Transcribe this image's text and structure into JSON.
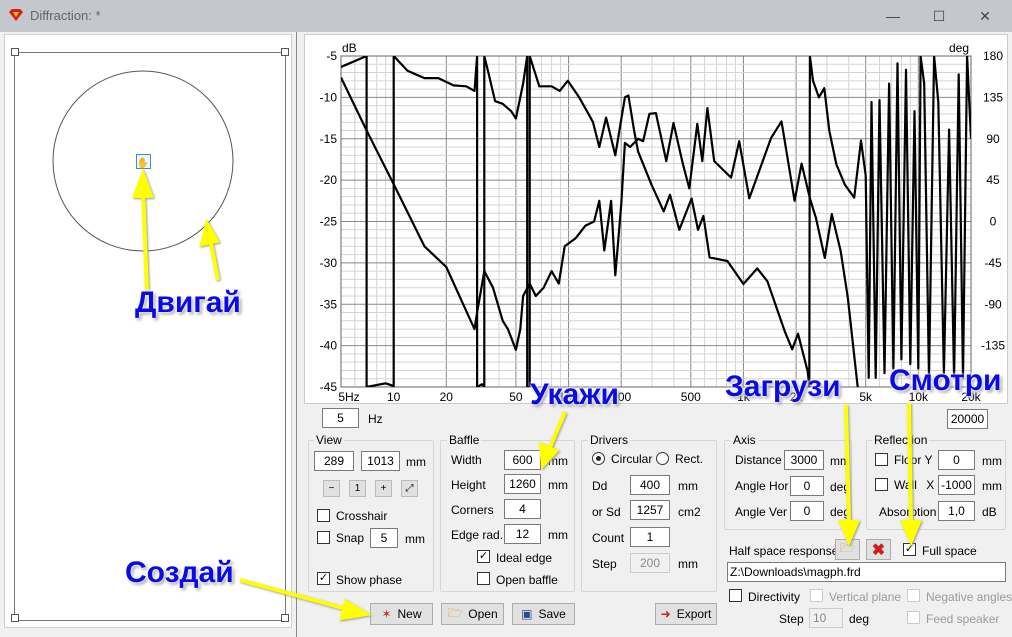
{
  "window": {
    "title": "Diffraction: *",
    "min": "—",
    "max": "☐",
    "close": "✕"
  },
  "chart_data": {
    "type": "line",
    "xscale": "log",
    "xlim": [
      5,
      20000
    ],
    "ylim": [
      -45,
      -5
    ],
    "y2lim": [
      -180,
      180
    ],
    "ylabel": "dB",
    "y2label": "deg",
    "grid": true,
    "xticks": [
      "5Hz",
      "10",
      "20",
      "50",
      "100",
      "200",
      "500",
      "1k",
      "2k",
      "5k",
      "10k",
      "20k"
    ],
    "xtick_values": [
      5,
      10,
      20,
      50,
      100,
      200,
      500,
      1000,
      2000,
      5000,
      10000,
      20000
    ],
    "yticks": [
      -5,
      -10,
      -15,
      -20,
      -25,
      -30,
      -35,
      -40,
      -45
    ],
    "y2ticks": [
      180,
      135,
      90,
      45,
      0,
      -45,
      -90,
      -135
    ],
    "series": [
      {
        "axis": "left",
        "points": [
          [
            5,
            -7.6
          ],
          [
            7,
            -14
          ],
          [
            10,
            -20.5
          ],
          [
            15,
            -28
          ],
          [
            20,
            -30.5
          ],
          [
            25,
            -35
          ],
          [
            29,
            -38
          ],
          [
            30,
            -36
          ],
          [
            33,
            -31
          ],
          [
            37,
            -33
          ],
          [
            42,
            -37
          ],
          [
            45,
            -38
          ],
          [
            50,
            -40.5
          ],
          [
            53,
            -38
          ],
          [
            55,
            -34
          ],
          [
            60,
            -32.5
          ],
          [
            65,
            -34
          ],
          [
            72,
            -33
          ],
          [
            80,
            -31
          ],
          [
            88,
            -32.5
          ],
          [
            95,
            -28
          ],
          [
            110,
            -27
          ],
          [
            125,
            -25.5
          ],
          [
            140,
            -25
          ],
          [
            150,
            -22.5
          ],
          [
            160,
            -28.5
          ],
          [
            175,
            -22.5
          ],
          [
            185,
            -31.5
          ],
          [
            200,
            -23
          ],
          [
            210,
            -15.5
          ],
          [
            225,
            -16
          ],
          [
            250,
            -15
          ],
          [
            267,
            -15.3
          ],
          [
            290,
            -12
          ],
          [
            316,
            -11.9
          ],
          [
            362,
            -17.7
          ],
          [
            398,
            -13.1
          ],
          [
            450,
            -18
          ],
          [
            490,
            -21
          ],
          [
            545,
            -13.2
          ],
          [
            582,
            -17.7
          ],
          [
            622,
            -11.3
          ],
          [
            680,
            -17.7
          ],
          [
            850,
            -19.7
          ],
          [
            945,
            -15.3
          ],
          [
            1080,
            -22.2
          ],
          [
            1440,
            -14.9
          ],
          [
            1650,
            -12.9
          ],
          [
            1960,
            -22.5
          ],
          [
            2150,
            -18
          ],
          [
            2400,
            -22.2
          ],
          [
            2600,
            -24.6
          ],
          [
            2920,
            -29.4
          ],
          [
            3200,
            -24.1
          ],
          [
            3600,
            -28.6
          ],
          [
            3950,
            -34.2
          ],
          [
            4500,
            -45
          ]
        ]
      },
      {
        "axis": "right",
        "points": [
          [
            5,
            168
          ],
          [
            7,
            180
          ],
          [
            7,
            -180
          ],
          [
            9,
            -176
          ],
          [
            10,
            -179
          ],
          [
            10,
            180
          ],
          [
            12,
            164
          ],
          [
            15,
            156
          ],
          [
            18,
            156
          ],
          [
            22,
            148
          ],
          [
            26,
            147
          ],
          [
            29,
            142
          ],
          [
            30,
            180
          ],
          [
            30,
            -180
          ],
          [
            32,
            -177
          ],
          [
            33,
            -180
          ],
          [
            33,
            180
          ],
          [
            35,
            160
          ],
          [
            38,
            131
          ],
          [
            42,
            128
          ],
          [
            47,
            120
          ],
          [
            50,
            112
          ],
          [
            55,
            150
          ],
          [
            58,
            180
          ],
          [
            58,
            -180
          ],
          [
            60,
            -180
          ],
          [
            60,
            180
          ],
          [
            68,
            147
          ],
          [
            80,
            147
          ],
          [
            89,
            142
          ],
          [
            99,
            153
          ],
          [
            115,
            135
          ],
          [
            130,
            117
          ],
          [
            138,
            108
          ],
          [
            150,
            81
          ],
          [
            164,
            113
          ],
          [
            185,
            72
          ],
          [
            210,
            135
          ],
          [
            220,
            137
          ],
          [
            237,
            99
          ],
          [
            250,
            76
          ],
          [
            298,
            40
          ],
          [
            350,
            11
          ],
          [
            380,
            29
          ],
          [
            430,
            -9
          ],
          [
            505,
            25
          ],
          [
            550,
            -9
          ],
          [
            590,
            6
          ],
          [
            640,
            -39
          ],
          [
            810,
            -43
          ],
          [
            1000,
            -68
          ],
          [
            1200,
            -51
          ],
          [
            1370,
            -65
          ],
          [
            1720,
            -119
          ],
          [
            1900,
            -139
          ],
          [
            2050,
            -122
          ],
          [
            2330,
            -163
          ],
          [
            2380,
            -180
          ],
          [
            2400,
            180
          ],
          [
            2500,
            153
          ],
          [
            2700,
            135
          ],
          [
            2900,
            145
          ],
          [
            3100,
            98
          ],
          [
            3400,
            62
          ],
          [
            3800,
            40
          ],
          [
            4300,
            26
          ],
          [
            4700,
            88
          ],
          [
            5000,
            50
          ],
          [
            5200,
            -170
          ],
          [
            5400,
            130
          ],
          [
            5700,
            -170
          ],
          [
            6000,
            132
          ],
          [
            6400,
            -165
          ],
          [
            6800,
            150
          ],
          [
            7200,
            -160
          ],
          [
            7600,
            172
          ],
          [
            8000,
            -150
          ],
          [
            8500,
            165
          ],
          [
            9000,
            -155
          ],
          [
            9500,
            120
          ],
          [
            10000,
            -160
          ],
          [
            10300,
            180
          ],
          [
            10800,
            150
          ],
          [
            11500,
            -170
          ],
          [
            12300,
            180
          ],
          [
            13000,
            130
          ],
          [
            14000,
            -165
          ],
          [
            15000,
            100
          ],
          [
            16000,
            -170
          ],
          [
            17000,
            160
          ],
          [
            18000,
            -170
          ],
          [
            19000,
            180
          ],
          [
            20000,
            90
          ]
        ]
      }
    ]
  },
  "freq": {
    "min": "5",
    "unit": "Hz",
    "max": "20000"
  },
  "view": {
    "label": "View",
    "w": "289",
    "h": "1013",
    "unit": "mm",
    "crosshair": "Crosshair",
    "snap": "Snap",
    "snap_value": "5",
    "snap_unit": "mm",
    "show_phase": "Show phase"
  },
  "baffle": {
    "label": "Baffle",
    "width_label": "Width",
    "width": "600",
    "height_label": "Height",
    "height": "1260",
    "corners_label": "Corners",
    "corners": "4",
    "edge_label": "Edge rad.",
    "edge": "12",
    "unit": "mm",
    "ideal_edge": "Ideal edge",
    "open_baffle": "Open baffle"
  },
  "drivers": {
    "label": "Drivers",
    "circular": "Circular",
    "rect": "Rect.",
    "dd_label": "Dd",
    "dd": "400",
    "sd_label": "or Sd",
    "sd": "1257",
    "count_label": "Count",
    "count": "1",
    "step_label": "Step",
    "step": "200",
    "mm": "mm",
    "cm2": "cm2"
  },
  "axis": {
    "label": "Axis",
    "distance_label": "Distance",
    "distance": "3000",
    "unit": "mm",
    "hor_label": "Angle Hor",
    "hor": "0",
    "ver_label": "Angle Ver",
    "ver": "0",
    "deg": "deg"
  },
  "reflection": {
    "label": "Reflection",
    "floor_label": "Floor Y",
    "floor": "0",
    "wall_label": "Wall X",
    "wall": "-1000",
    "unit": "mm",
    "absorption_label": "Absorption",
    "absorption": "1,0",
    "db": "dB"
  },
  "halfspace": {
    "label": "Half space response",
    "full_space": "Full space",
    "path": "Z:\\Downloads\\magph.frd"
  },
  "directivity": {
    "label": "Directivity",
    "vertical": "Vertical plane",
    "negative": "Negative angles",
    "step_label": "Step",
    "step": "10",
    "deg": "deg",
    "feed": "Feed speaker"
  },
  "buttons": {
    "new": "New",
    "open": "Open",
    "save": "Save",
    "export": "Export"
  },
  "annotations": {
    "move": "Двигай",
    "create": "Создай",
    "specify": "Укажи",
    "load": "Загрузи",
    "look": "Смотри"
  },
  "colors": {
    "annotation_text": "#0a0ae6",
    "arrow": "#ffff00",
    "curve": "#000000"
  }
}
